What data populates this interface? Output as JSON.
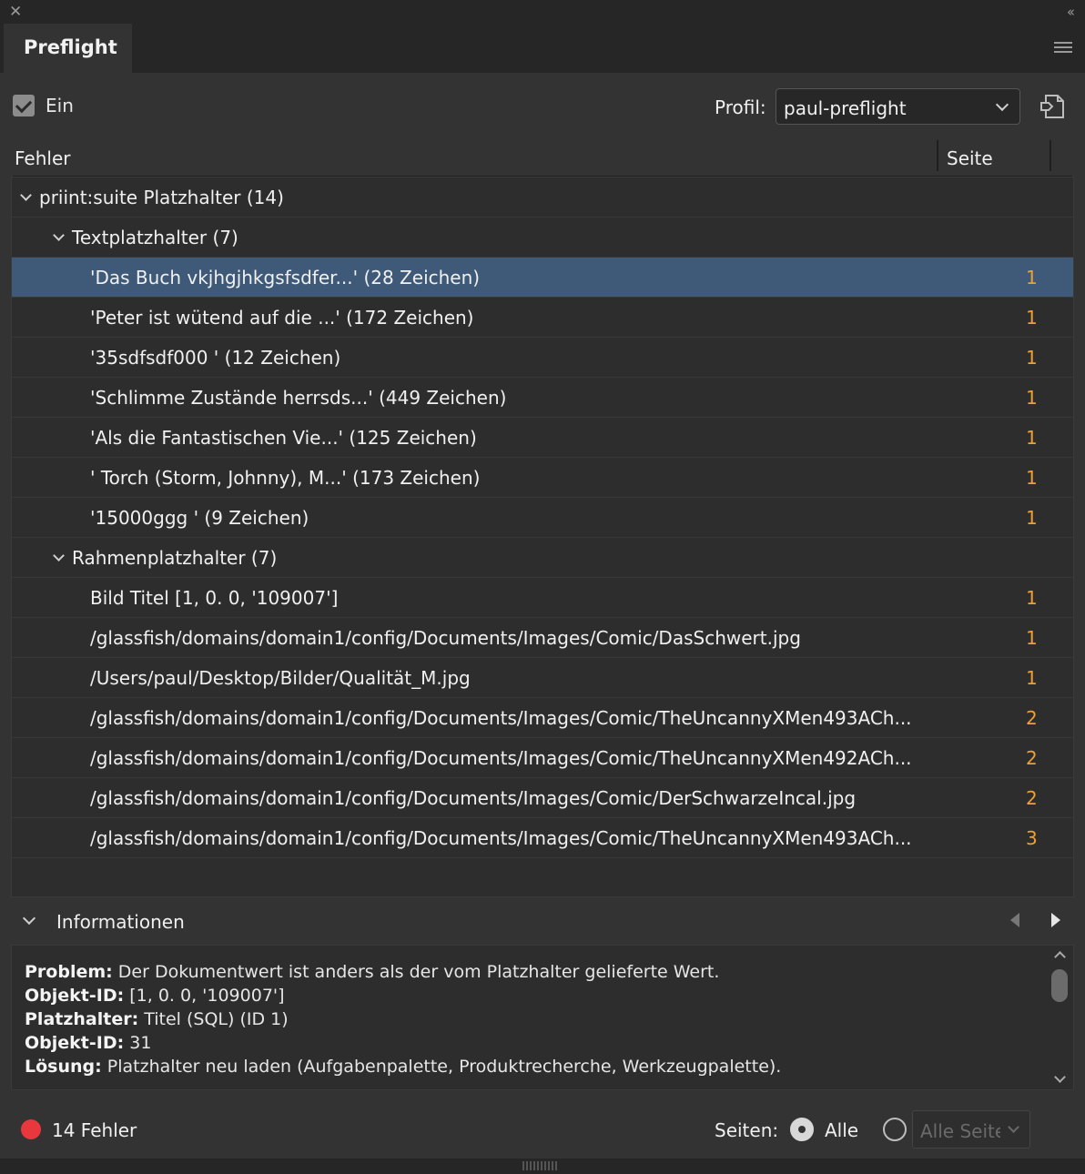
{
  "window": {
    "close_icon": "close-icon",
    "collapse_icon": "double-chevron-left-icon"
  },
  "tab": {
    "label": "Preflight"
  },
  "toolbar": {
    "on_label": "Ein",
    "profile_label": "Profil:",
    "profile_value": "paul-preflight"
  },
  "columns": {
    "error": "Fehler",
    "page": "Seite"
  },
  "tree": {
    "root": {
      "label": "priint:suite Platzhalter (14)"
    },
    "text_group": {
      "label": "Textplatzhalter  (7)",
      "items": [
        {
          "label": "'Das Buch vkjhgjhkgsfsdfer...' (28 Zeichen)",
          "page": "1"
        },
        {
          "label": "'Peter ist wütend auf die ...' (172 Zeichen)",
          "page": "1"
        },
        {
          "label": "'35sdfsdf000 ' (12 Zeichen)",
          "page": "1"
        },
        {
          "label": "'Schlimme Zustände herrsds...' (449 Zeichen)",
          "page": "1"
        },
        {
          "label": "'Als die Fantastischen Vie...' (125 Zeichen)",
          "page": "1"
        },
        {
          "label": "' Torch (Storm, Johnny), M...' (173 Zeichen)",
          "page": "1"
        },
        {
          "label": "'15000ggg ' (9 Zeichen)",
          "page": "1"
        }
      ]
    },
    "frame_group": {
      "label": "Rahmenplatzhalter  (7)",
      "items": [
        {
          "label": "Bild Titel [1, 0. 0, '109007']",
          "page": "1"
        },
        {
          "label": "/glassfish/domains/domain1/config/Documents/Images/Comic/DasSchwert.jpg",
          "page": "1"
        },
        {
          "label": "/Users/paul/Desktop/Bilder/Qualität_M.jpg",
          "page": "1"
        },
        {
          "label": "/glassfish/domains/domain1/config/Documents/Images/Comic/TheUncannyXMen493ACh...",
          "page": "2"
        },
        {
          "label": "/glassfish/domains/domain1/config/Documents/Images/Comic/TheUncannyXMen492ACh...",
          "page": "2"
        },
        {
          "label": "/glassfish/domains/domain1/config/Documents/Images/Comic/DerSchwarzeIncal.jpg",
          "page": "2"
        },
        {
          "label": "/glassfish/domains/domain1/config/Documents/Images/Comic/TheUncannyXMen493ACh...",
          "page": "3"
        }
      ]
    }
  },
  "info": {
    "title": "Informationen",
    "lines": [
      {
        "key": "Problem:",
        "value": " Der Dokumentwert ist anders als der vom Platzhalter gelieferte Wert."
      },
      {
        "key": "Objekt-ID:",
        "value": " [1, 0. 0, '109007']"
      },
      {
        "key": "Platzhalter:",
        "value": " Titel (SQL) (ID 1)"
      },
      {
        "key": "Objekt-ID:",
        "value": " 31"
      },
      {
        "key": "Lösung:",
        "value": " Platzhalter neu laden (Aufgabenpalette, Produktrecherche, Werkzeugpalette)."
      }
    ]
  },
  "status": {
    "errors": "14 Fehler",
    "pages_label": "Seiten:",
    "all_label": "Alle",
    "range_value": "Alle Seiten",
    "error_color": "#e8383d"
  },
  "colors": {
    "selection": "#3f5a78",
    "page_number": "#f0a030"
  }
}
